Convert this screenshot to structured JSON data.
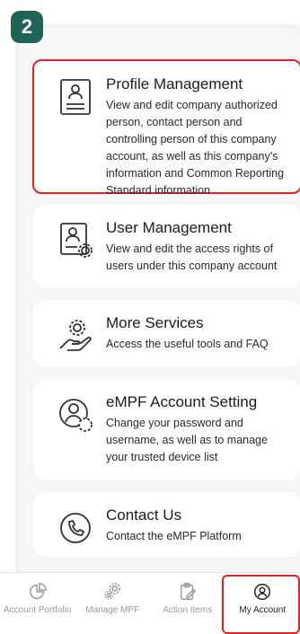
{
  "step": "2",
  "menu": [
    {
      "title": "Profile Management",
      "desc": "View and edit company authorized person, contact person and controlling person of this company account, as well as this company's information and Common Reporting Standard information"
    },
    {
      "title": "User Management",
      "desc": "View and edit the access rights of users under this company account"
    },
    {
      "title": "More Services",
      "desc": "Access the useful tools and FAQ"
    },
    {
      "title": "eMPF Account Setting",
      "desc": "Change your password and username, as well as to manage your trusted device list"
    },
    {
      "title": "Contact Us",
      "desc": "Contact the eMPF Platform"
    }
  ],
  "nav": [
    {
      "label": "Account Portfolio",
      "icon": "pie-chart-icon"
    },
    {
      "label": "Manage MPF",
      "icon": "gears-icon"
    },
    {
      "label": "Action Items",
      "icon": "clipboard-edit-icon"
    },
    {
      "label": "My Account",
      "icon": "user-circle-icon"
    }
  ],
  "colors": {
    "accent": "#1f6455",
    "highlight": "#e02323"
  }
}
